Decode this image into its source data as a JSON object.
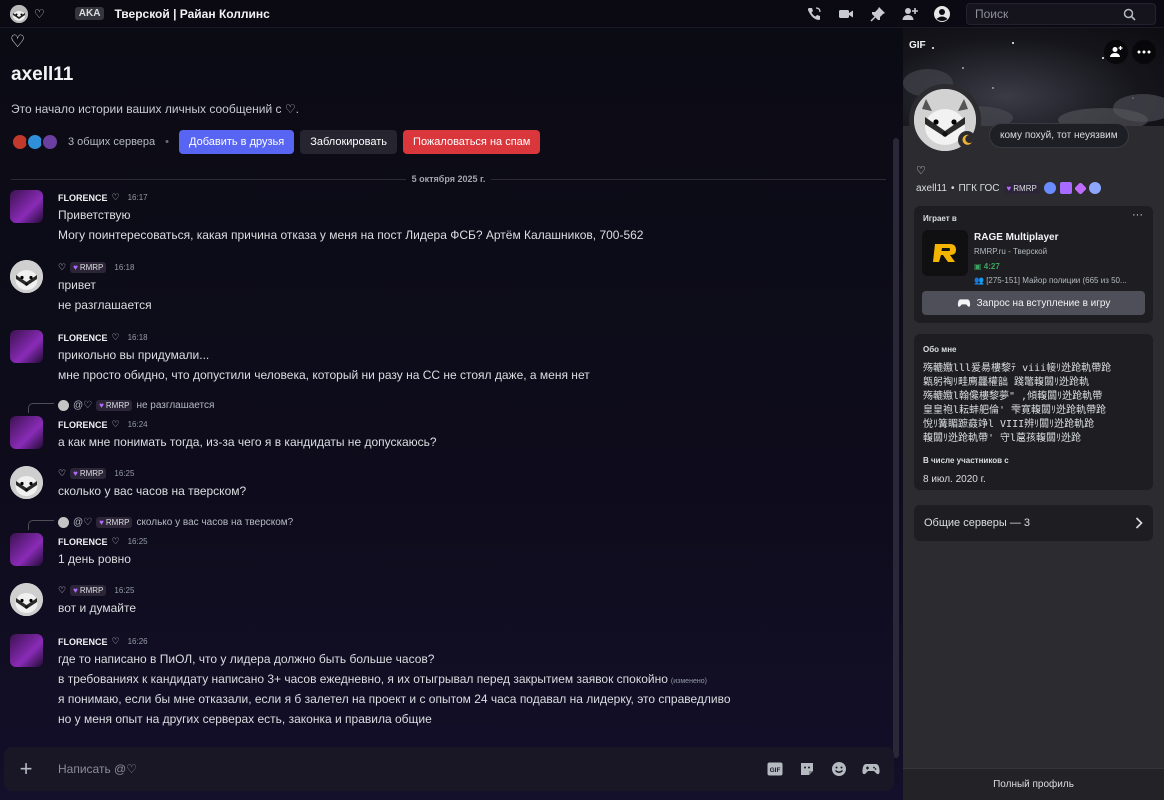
{
  "topbar": {
    "heart": "♡",
    "tag": "AKA",
    "name": "Тверской | Райан Коллинс",
    "search_placeholder": "Поиск",
    "icons": [
      "phone-icon",
      "video-icon",
      "pin-icon",
      "add-member-icon",
      "user-profile-icon",
      "search-icon"
    ]
  },
  "intro": {
    "heart": "♡",
    "username": "axell11",
    "text": "Это начало истории ваших личных сообщений с ♡.",
    "mutual_servers": "3 общих сервера",
    "dot": "•",
    "add_friend": "Добавить в друзья",
    "block": "Заблокировать",
    "report_spam": "Пожаловаться на спам"
  },
  "date_divider": "5 октября 2025 г.",
  "messages": [
    {
      "author": "FLORENCE",
      "heart": "♡",
      "time": "16:17",
      "lines": [
        "Приветствую",
        "Могу поинтересоваться, какая причина отказа у меня на пост Лидера ФСБ? Артём Калашников, 700-562"
      ]
    },
    {
      "author": "♡",
      "tag": "RMRP",
      "time": "16:18",
      "lines": [
        "привет",
        "не разглашается"
      ]
    },
    {
      "author": "FLORENCE",
      "heart": "♡",
      "time": "16:18",
      "lines": [
        "прикольно вы придумали...",
        "мне просто обидно, что допустили человека, который ни разу на СС не стоял даже, а меня нет"
      ]
    },
    {
      "reply": {
        "mention": "@♡",
        "tag": "RMRP",
        "text": "не разглашается"
      },
      "author": "FLORENCE",
      "heart": "♡",
      "time": "16:24",
      "lines": [
        "а как мне понимать тогда, из-за чего я в кандидаты не допускаюсь?"
      ]
    },
    {
      "author": "♡",
      "tag": "RMRP",
      "time": "16:25",
      "lines": [
        "сколько у вас часов на тверском?"
      ]
    },
    {
      "reply": {
        "mention": "@♡",
        "tag": "RMRP",
        "text": "сколько у вас часов на тверском?"
      },
      "author": "FLORENCE",
      "heart": "♡",
      "time": "16:25",
      "lines": [
        "1 день ровно"
      ]
    },
    {
      "author": "♡",
      "tag": "RMRP",
      "time": "16:25",
      "lines": [
        "вот и думайте"
      ]
    },
    {
      "author": "FLORENCE",
      "heart": "♡",
      "time": "16:26",
      "lines": [
        "где то написано в ПиОЛ, что у лидера должно быть больше часов?",
        "в требованиях к кандидату написано 3+ часов ежедневно, я их отыгрывал перед закрытием заявок спокойно",
        "я понимаю, если бы мне отказали, если я б залетел на проект и с опытом 24 часа подавал на лидерку, это справедливо",
        "но у меня опыт на других серверах есть, законка и правила общие"
      ],
      "edited": "(изменено)"
    }
  ],
  "composer": {
    "placeholder": "Написать @♡",
    "icons": [
      "gif-icon",
      "sticker-icon",
      "emoji-icon",
      "activity-icon"
    ]
  },
  "profile": {
    "gif_badge": "GIF",
    "status_bubble": "кому похуй, тот неуязвим",
    "heart": "♡",
    "username": "axell11",
    "dot": "•",
    "server_tag": "ПГК ГОС",
    "badge_tag": "RMRP",
    "playing_title": "Играет в",
    "more": "···",
    "game_name": "RAGE Multiplayer",
    "game_server": "RMRP.ru - Тверской",
    "game_time": "4:27",
    "game_state": "[275-151] Майор полиции (665 из 50...",
    "join_button": "Запрос на вступление в игру",
    "about_title": "Обо мне",
    "about_lines": [
      "殇轆嫐lll爰昜樓黎ﾃ           viii帹ﾘ迯跄軌帶跄",
      "甈躬祹ﾘ畦廌龘權韷             踐鼈輹闒ﾘ迯跄軌",
      "殇轆嫐l翰儳樓黎夢\"      ,傾輹闒ﾘ迯跄軌帶",
      "皇皇袍l耘蚌舥倫'           雫寛輹闒ﾘ迯跄軌帶跄",
      "悅ﾘ篝睸蹠鼖竫l            VIII辨ﾘ闒ﾘ迯跄軌跄",
      "輹闒ﾘ迯跄軌帶'               守l蔰孩輹闒ﾘ迯跄"
    ],
    "member_since_title": "В числе участников с",
    "member_since": "8 июл. 2020 г.",
    "mutual_servers": "Общие серверы — 3",
    "full_profile": "Полный профиль"
  }
}
